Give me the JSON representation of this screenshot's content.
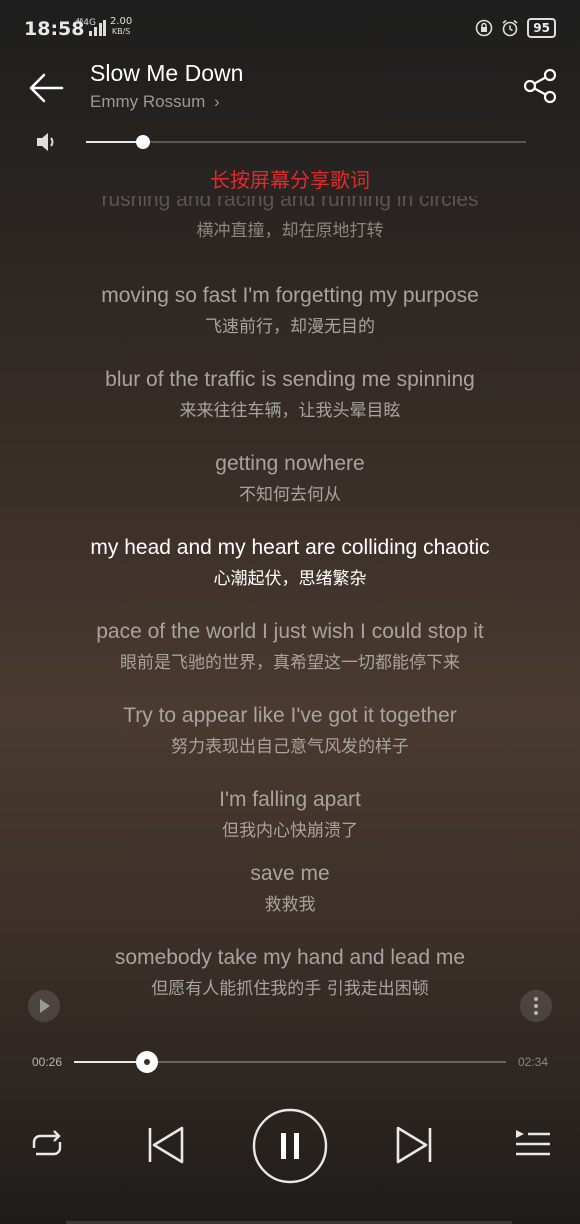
{
  "status": {
    "time": "18:58",
    "network": "⁴⁶4G",
    "speed_value": "2.00",
    "speed_unit": "KB/S",
    "battery": "95",
    "icons": [
      "lock-rotation-icon",
      "alarm-icon",
      "battery-icon"
    ]
  },
  "header": {
    "title": "Slow Me Down",
    "artist": "Emmy Rossum",
    "artist_chevron": "›"
  },
  "volume": {
    "level": 0.13
  },
  "hint": "长按屏幕分享歌词",
  "lyrics": [
    {
      "en": "rushing and racing and running in circles",
      "zh": "横冲直撞，却在原地打转",
      "state": "faded"
    },
    {
      "en": "moving so fast I'm forgetting my purpose",
      "zh": "飞速前行，却漫无目的",
      "state": "normal"
    },
    {
      "en": "blur of the traffic is sending me spinning",
      "zh": "来来往往车辆，让我头晕目眩",
      "state": "normal"
    },
    {
      "en": "getting nowhere",
      "zh": "不知何去何从",
      "state": "normal"
    },
    {
      "en": "my head and my heart are colliding chaotic",
      "zh": "心潮起伏，思绪繁杂",
      "state": "current"
    },
    {
      "en": "pace of the world I just wish I could stop it",
      "zh": "眼前是飞驰的世界，真希望这一切都能停下来",
      "state": "normal"
    },
    {
      "en": "Try to appear like I've got it together",
      "zh": "努力表现出自己意气风发的样子",
      "state": "normal"
    },
    {
      "en": "I'm falling apart",
      "zh": "但我内心快崩溃了",
      "state": "normal"
    },
    {
      "en": "save me",
      "zh": "救救我",
      "state": "normal"
    },
    {
      "en": "somebody take my hand and lead me",
      "zh": "但愿有人能抓住我的手 引我走出困顿",
      "state": "normal"
    }
  ],
  "progress": {
    "elapsed": "00:26",
    "total": "02:34",
    "fraction": 0.169
  },
  "colors": {
    "hint": "#e02c2c",
    "current_line": "#ffffff",
    "other_line": "#a8a39e"
  }
}
